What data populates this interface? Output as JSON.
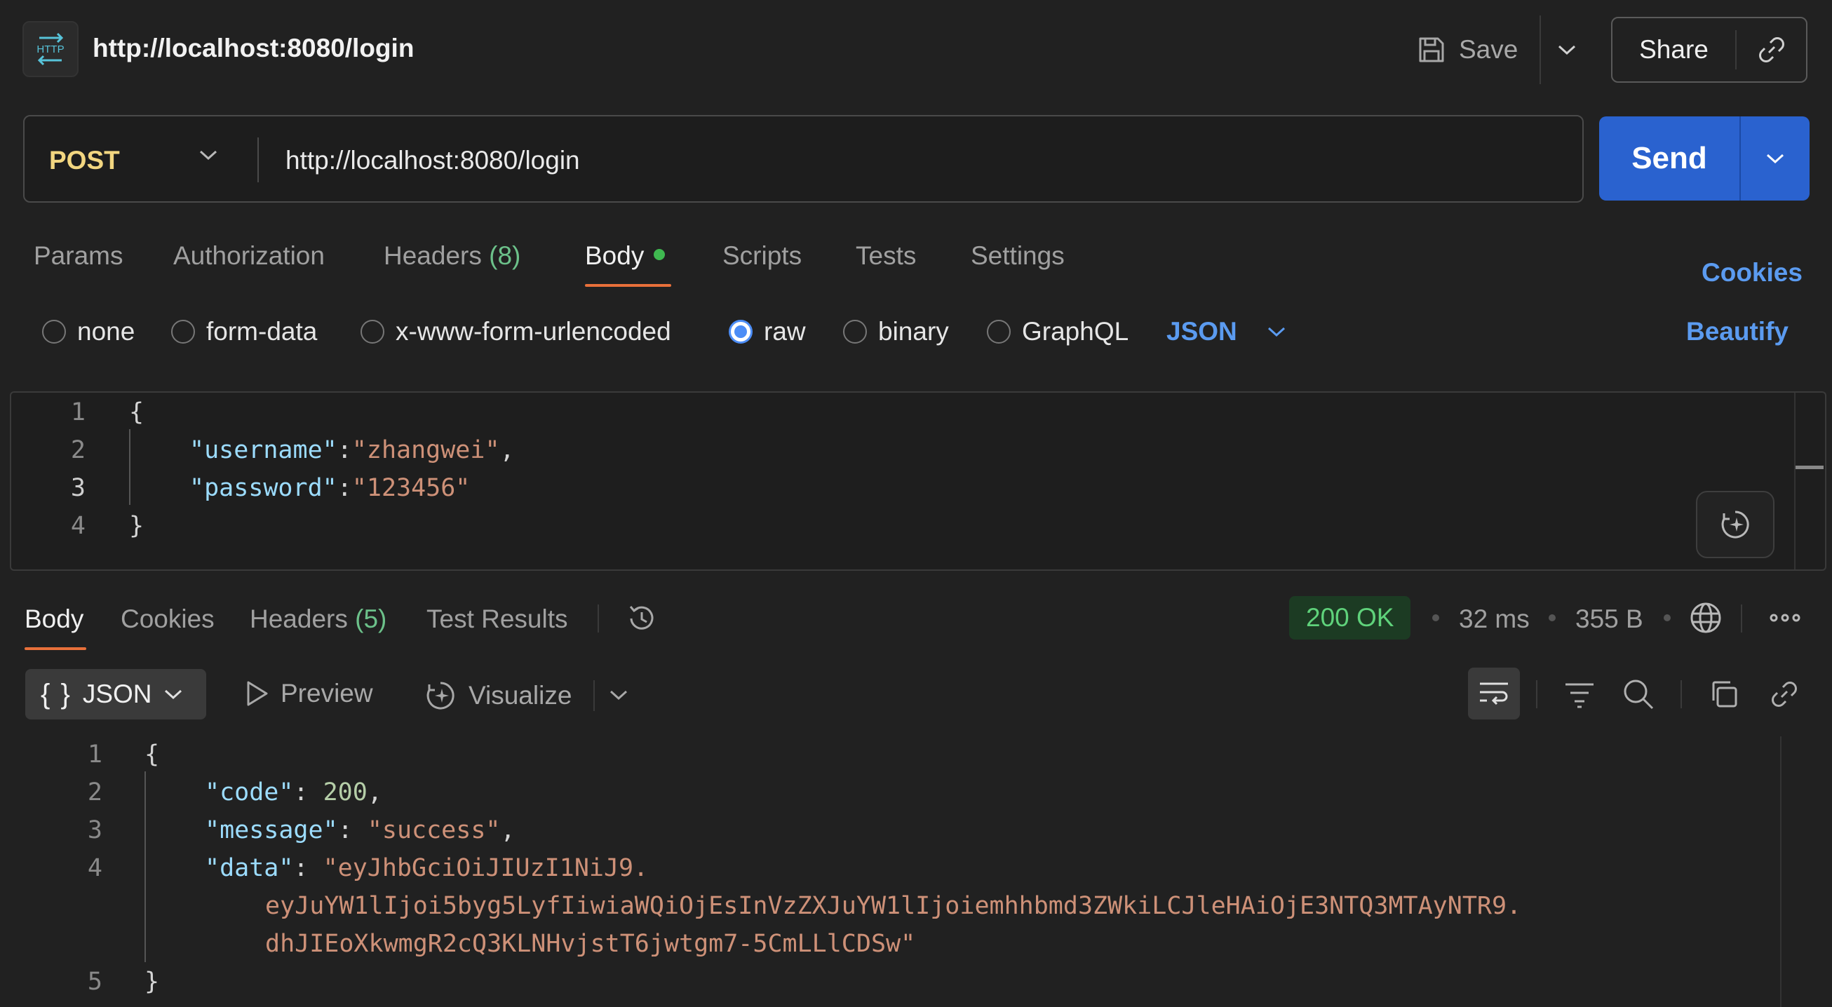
{
  "header": {
    "icon_text": "HTTP",
    "title": "http://localhost:8080/login",
    "save_label": "Save",
    "share_label": "Share"
  },
  "request": {
    "method": "POST",
    "url": "http://localhost:8080/login",
    "send_label": "Send"
  },
  "request_tabs": {
    "params": "Params",
    "authorization": "Authorization",
    "headers": "Headers",
    "headers_count": "(8)",
    "body": "Body",
    "scripts": "Scripts",
    "tests": "Tests",
    "settings": "Settings",
    "cookies": "Cookies"
  },
  "body_types": {
    "none": "none",
    "form_data": "form-data",
    "urlencoded": "x-www-form-urlencoded",
    "raw": "raw",
    "binary": "binary",
    "graphql": "GraphQL",
    "format": "JSON",
    "beautify": "Beautify"
  },
  "request_body": {
    "ln1": "1",
    "ln2": "2",
    "ln3": "3",
    "ln4": "4",
    "open": "{",
    "username_key": "\"username\"",
    "username_val": "\"zhangwei\"",
    "password_key": "\"password\"",
    "password_val": "\"123456\"",
    "close": "}"
  },
  "response_tabs": {
    "body": "Body",
    "cookies": "Cookies",
    "headers": "Headers",
    "headers_count": "(5)",
    "test_results": "Test Results"
  },
  "response_meta": {
    "status": "200 OK",
    "time": "32 ms",
    "size": "355 B"
  },
  "response_toolbar": {
    "format": "JSON",
    "preview": "Preview",
    "visualize": "Visualize"
  },
  "response_body": {
    "ln1": "1",
    "ln2": "2",
    "ln3": "3",
    "ln4": "4",
    "ln5": "5",
    "open": "{",
    "code_key": "\"code\"",
    "code_val": "200",
    "message_key": "\"message\"",
    "message_val": "\"success\"",
    "data_key": "\"data\"",
    "data_val_1": "\"eyJhbGciOiJIUzI1NiJ9.",
    "data_val_2": "eyJuYW1lIjoi5byg5LyfIiwiaWQiOjEsInVzZXJuYW1lIjoiemhhbmd3ZWkiLCJleHAiOjE3NTQ3MTAyNTR9.",
    "data_val_3": "dhJIEoXkwmgR2cQ3KLNHvjstT6jwtgm7-5CmLLlCDSw\"",
    "close": "}"
  },
  "colors": {
    "accent_blue": "#2a62cf",
    "method_yellow": "#f2d680",
    "status_green": "#5fd27b",
    "tab_underline": "#e8703a"
  },
  "icons": [
    "http-icon",
    "save-icon",
    "chevron-down-icon",
    "link-icon",
    "history-icon",
    "globe-icon",
    "more-icon",
    "play-icon",
    "visualize-icon",
    "wrap-icon",
    "filter-icon",
    "search-icon",
    "copy-icon",
    "ai-assist-icon"
  ]
}
